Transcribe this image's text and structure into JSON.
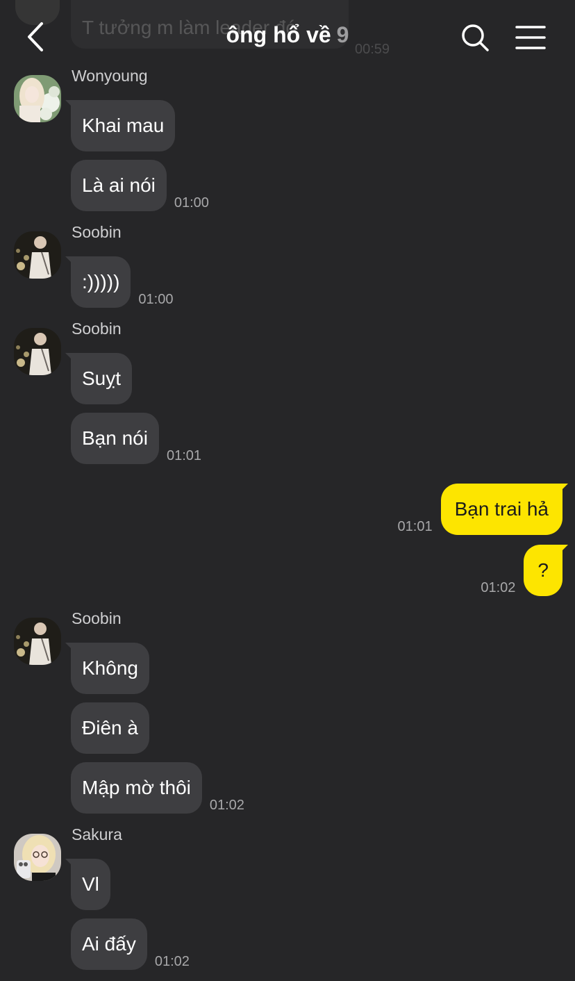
{
  "header": {
    "title": "ông hổ về",
    "member_count": "9",
    "back_icon": "chevron-left-icon",
    "search_icon": "search-icon",
    "menu_icon": "menu-icon"
  },
  "previous_message": {
    "text": "T tưởng m làm leader đó",
    "time": "00:59"
  },
  "messages": [
    {
      "sender": "Wonyoung",
      "avatar": "photo-avatar-flowers",
      "bubbles": [
        "Khai mau",
        "Là ai nói"
      ],
      "time": "01:00"
    },
    {
      "sender": "Soobin",
      "avatar": "photo-avatar-night",
      "bubbles": [
        ":)))))"
      ],
      "time": "01:00"
    },
    {
      "sender": "Soobin",
      "avatar": "photo-avatar-night",
      "bubbles": [
        "Suỵt",
        "Bạn nói"
      ],
      "time": "01:01"
    },
    {
      "mine": true,
      "bubbles": [
        {
          "text": "Bạn trai hả",
          "time": "01:01"
        },
        {
          "text": "?",
          "time": "01:02"
        }
      ]
    },
    {
      "sender": "Soobin",
      "avatar": "photo-avatar-night",
      "bubbles": [
        "Không",
        "Điên à",
        "Mập mờ thôi"
      ],
      "time": "01:02"
    },
    {
      "sender": "Sakura",
      "avatar": "photo-avatar-selfie",
      "bubbles": [
        "Vl",
        "Ai đấy"
      ],
      "time": "01:02"
    }
  ],
  "colors": {
    "background": "#262628",
    "incoming_bubble": "#3e3e41",
    "outgoing_bubble": "#fde500",
    "timestamp": "#a8a8aa"
  }
}
